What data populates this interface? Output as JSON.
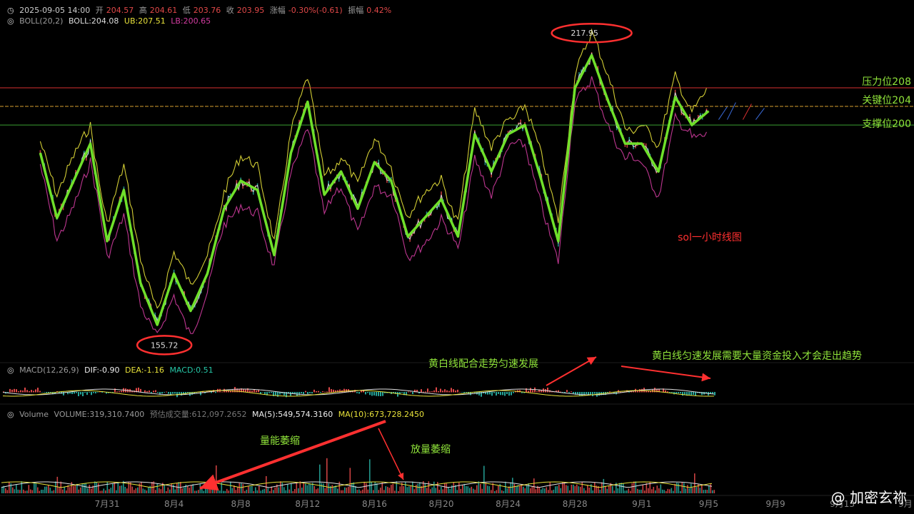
{
  "header": {
    "datetime": "2025-09-05 14:00",
    "open_label": "开",
    "open": "204.57",
    "high_label": "高",
    "high": "204.61",
    "low_label": "低",
    "low": "203.76",
    "close_label": "收",
    "close": "203.95",
    "change_label": "涨幅",
    "change": "-0.30%(-0.61)",
    "amp_label": "振幅",
    "amp": "0.42%"
  },
  "boll": {
    "name": "BOLL(20,2)",
    "mid": "BOLL:204.08",
    "ub": "UB:207.51",
    "lb": "LB:200.65"
  },
  "macd": {
    "name": "MACD(12,26,9)",
    "dif": "DIF:-0.90",
    "dea": "DEA:-1.16",
    "macd": "MACD:0.51"
  },
  "volume": {
    "name": "Volume",
    "vol": "VOLUME:319,310.7400",
    "est": "预估成交量:612,097.2652",
    "ma5": "MA(5):549,574.3160",
    "ma10": "MA(10):673,728.2450"
  },
  "colors": {
    "up": "#e04848",
    "down": "#26a69a",
    "boll_ub": "#e8e23a",
    "boll_lb": "#d23ca0",
    "boll_mid": "#e0e0e0",
    "trend": "#6fe02a",
    "annot_red": "#ff3030",
    "annot_green": "#8fe33a"
  },
  "chart_data": {
    "type": "line",
    "title": "sol一小时线图",
    "x_ticks": [
      "7月31",
      "8月4",
      "8月8",
      "8月12",
      "8月16",
      "8月20",
      "8月24",
      "8月28",
      "9月1",
      "9月5",
      "9月9",
      "9月13",
      "9月"
    ],
    "levels": [
      {
        "label": "压力位208",
        "value": 208
      },
      {
        "label": "关键位204",
        "value": 204
      },
      {
        "label": "支撑位200",
        "value": 200
      }
    ],
    "extremes": [
      {
        "label": "217.95",
        "value": 217.95,
        "date": "8月29"
      },
      {
        "label": "155.72",
        "value": 155.72,
        "date": "8月3"
      }
    ],
    "trend_series": {
      "name": "",
      "x": [
        "7月27",
        "7月28",
        "7月30",
        "7月31",
        "8月1",
        "8月2",
        "8月3",
        "8月4",
        "8月5",
        "8月6",
        "8月7",
        "8月8",
        "8月9",
        "8月10",
        "8月11",
        "8月12",
        "8月13",
        "8月14",
        "8月15",
        "8月16",
        "8月17",
        "8月18",
        "8月19",
        "8月20",
        "8月21",
        "8月22",
        "8月23",
        "8月24",
        "8月25",
        "8月26",
        "8月27",
        "8月28",
        "8月29",
        "8月30",
        "8月31",
        "9月1",
        "9月2",
        "9月3",
        "9月4",
        "9月5"
      ],
      "y": [
        194,
        180,
        196,
        175,
        186,
        166,
        157,
        168,
        160,
        168,
        182,
        188,
        186,
        172,
        194,
        205,
        185,
        190,
        182,
        192,
        188,
        176,
        180,
        184,
        176,
        198,
        190,
        198,
        200,
        188,
        175,
        208,
        215,
        205,
        196,
        196,
        190,
        206,
        200,
        203
      ]
    },
    "annotations": [
      "黄白线配合走势匀速发展",
      "黄白线匀速发展需要大量资金投入才会走出趋势",
      "量能萎缩",
      "放量萎缩"
    ]
  },
  "watermark": "@ 加密玄祢"
}
